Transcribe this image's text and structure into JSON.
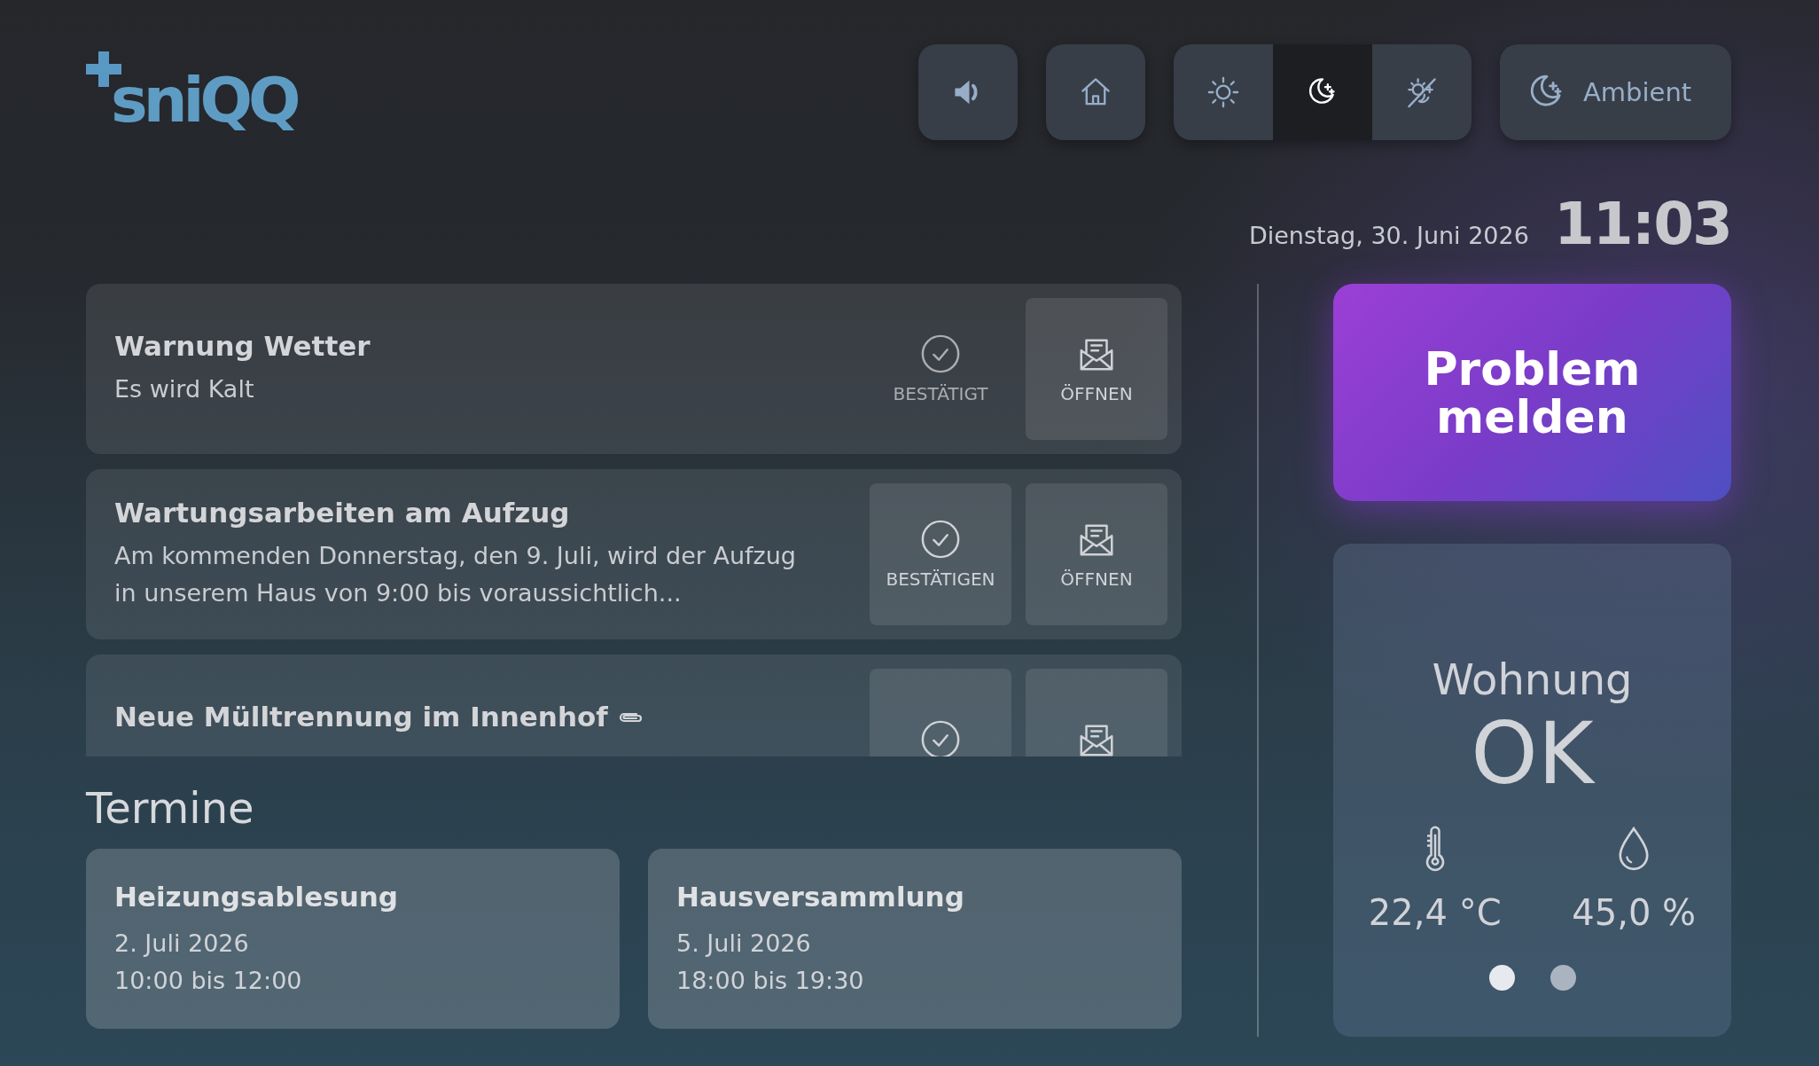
{
  "logo": {
    "text": "sniQQ"
  },
  "toolbar": {
    "mode_switch": [
      {
        "selected": false
      },
      {
        "selected": true
      },
      {
        "selected": false
      }
    ],
    "ambient_button": {
      "label": "Ambient"
    }
  },
  "datetime": {
    "date": "Dienstag, 30. Juni 2026",
    "time": "11:03"
  },
  "messages": [
    {
      "title": "Warnung Wetter",
      "body": "Es wird Kalt",
      "attachment": false,
      "confirmed": true,
      "confirm_label": "BESTÄTIGT",
      "open_label": "ÖFFNEN"
    },
    {
      "title": "Wartungsarbeiten am Aufzug",
      "body": "Am kommenden Donnerstag, den 9. Juli, wird der Aufzug in unserem Haus von 9:00 bis voraussichtlich...",
      "attachment": false,
      "confirmed": false,
      "confirm_label": "BESTÄTIGEN",
      "open_label": "ÖFFNEN"
    },
    {
      "title": "Neue Mülltrennung im Innenhof",
      "attachment": true,
      "confirmed": false
    }
  ],
  "appointments_title": "Termine",
  "appointments": [
    {
      "title": "Heizungsablesung",
      "date": "2. Juli 2026",
      "time": "10:00 bis 12:00"
    },
    {
      "title": "Hausversammlung",
      "date": "5. Juli 2026",
      "time": "18:00 bis 19:30"
    }
  ],
  "report_button": {
    "label": "Problem melden"
  },
  "status_card": {
    "title": "Wohnung",
    "status": "OK",
    "temperature": "22,4 °C",
    "humidity": "45,0 %",
    "pages": [
      {
        "selected": true
      },
      {
        "selected": false
      }
    ]
  }
}
